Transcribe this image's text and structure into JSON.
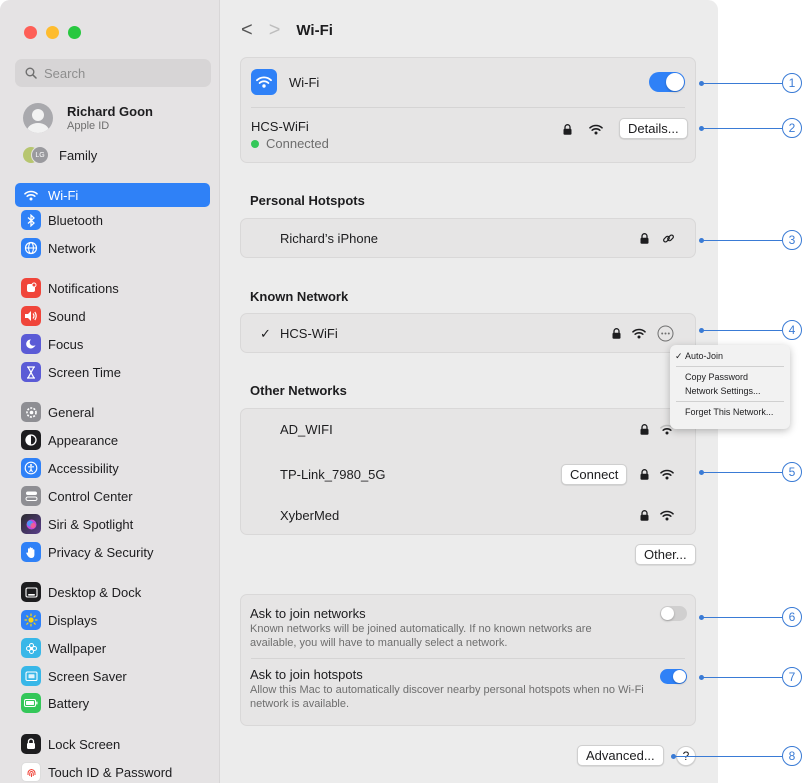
{
  "sidebar": {
    "search_placeholder": "Search",
    "profile": {
      "name": "Richard Goon",
      "subtitle": "Apple ID"
    },
    "family": {
      "label": "Family",
      "initials": "LG"
    },
    "items": [
      {
        "label": "Wi-Fi",
        "icon": "wifi-icon",
        "color": "#2f81f7"
      },
      {
        "label": "Bluetooth",
        "icon": "bluetooth-icon",
        "color": "#2f81f7"
      },
      {
        "label": "Network",
        "icon": "globe-icon",
        "color": "#2f81f7"
      },
      {
        "label": "Notifications",
        "icon": "bell-icon",
        "color": "#f0453a"
      },
      {
        "label": "Sound",
        "icon": "speaker-icon",
        "color": "#f0453a"
      },
      {
        "label": "Focus",
        "icon": "moon-icon",
        "color": "#5b5bd6"
      },
      {
        "label": "Screen Time",
        "icon": "hourglass-icon",
        "color": "#5b5bd6"
      },
      {
        "label": "General",
        "icon": "gear-icon",
        "color": "#8e8e93"
      },
      {
        "label": "Appearance",
        "icon": "appearance-icon",
        "color": "#1d1d1f"
      },
      {
        "label": "Accessibility",
        "icon": "accessibility-icon",
        "color": "#2f81f7"
      },
      {
        "label": "Control Center",
        "icon": "control-center-icon",
        "color": "#8e8e93"
      },
      {
        "label": "Siri & Spotlight",
        "icon": "siri-icon",
        "color": "#c04ad8"
      },
      {
        "label": "Privacy & Security",
        "icon": "hand-icon",
        "color": "#2f81f7"
      },
      {
        "label": "Desktop & Dock",
        "icon": "dock-icon",
        "color": "#1d1d1f"
      },
      {
        "label": "Displays",
        "icon": "sun-icon",
        "color": "#2f81f7"
      },
      {
        "label": "Wallpaper",
        "icon": "flower-icon",
        "color": "#38b7e8"
      },
      {
        "label": "Screen Saver",
        "icon": "screensaver-icon",
        "color": "#38b7e8"
      },
      {
        "label": "Battery",
        "icon": "battery-icon",
        "color": "#34c759"
      },
      {
        "label": "Lock Screen",
        "icon": "lock-icon",
        "color": "#1d1d1f"
      },
      {
        "label": "Touch ID & Password",
        "icon": "fingerprint-icon",
        "color": "#f0453a"
      }
    ]
  },
  "header": {
    "title": "Wi-Fi",
    "back": "<",
    "forward": ">"
  },
  "wifi": {
    "label": "Wi-Fi",
    "enabled": true
  },
  "current": {
    "name": "HCS-WiFi",
    "status": "Connected",
    "details_button": "Details..."
  },
  "personal_hotspots": {
    "title": "Personal Hotspots",
    "items": [
      {
        "name": "Richard’s iPhone"
      }
    ]
  },
  "known_network": {
    "title": "Known Network",
    "items": [
      {
        "name": "HCS-WiFi",
        "check": "✓"
      }
    ]
  },
  "context_menu": {
    "items": [
      "Auto-Join",
      "Copy Password",
      "Network Settings...",
      "Forget This Network..."
    ],
    "check": "✓"
  },
  "other_networks": {
    "title": "Other Networks",
    "items": [
      {
        "name": "AD_WIFI"
      },
      {
        "name": "TP-Link_7980_5G",
        "action": "Connect"
      },
      {
        "name": "XyberMed"
      }
    ],
    "other_button": "Other..."
  },
  "ask_networks": {
    "label": "Ask to join networks",
    "desc": "Known networks will be joined automatically. If no known networks are available, you will have to manually select a network.",
    "enabled": false
  },
  "ask_hotspots": {
    "label": "Ask to join hotspots",
    "desc": "Allow this Mac to automatically discover nearby personal hotspots when no Wi-Fi network is available.",
    "enabled": true
  },
  "footer": {
    "advanced_button": "Advanced...",
    "help_button": "?"
  },
  "callouts": [
    "1",
    "2",
    "3",
    "4",
    "5",
    "6",
    "7",
    "8"
  ],
  "colors": {
    "accent": "#2f81f7",
    "connected": "#34c759",
    "callout": "#3a7bd5"
  }
}
